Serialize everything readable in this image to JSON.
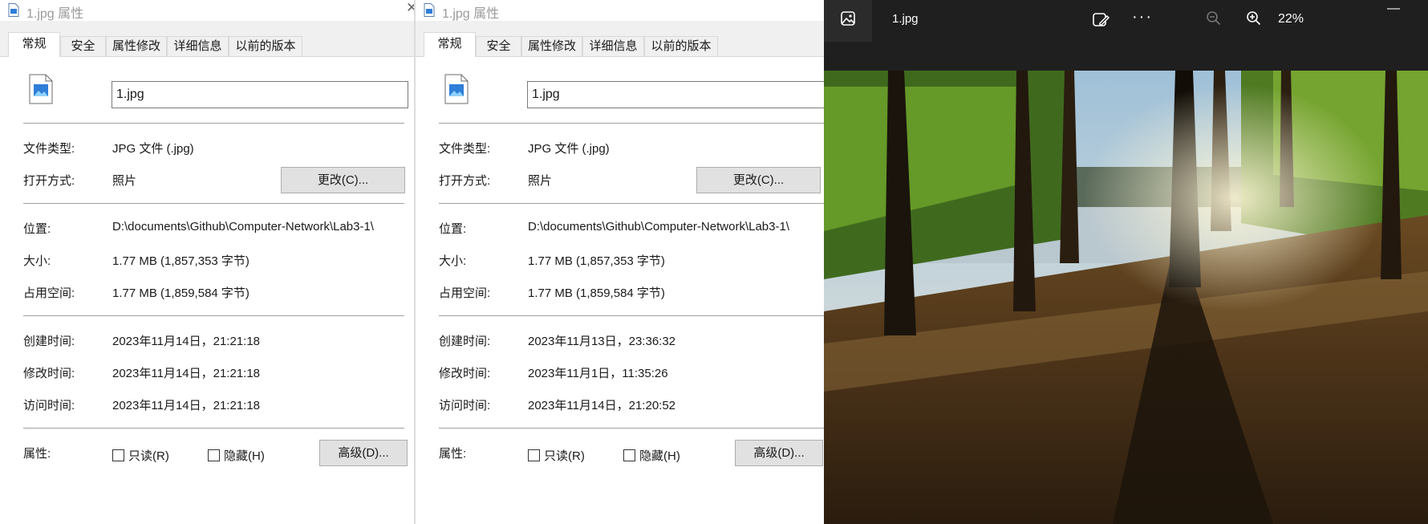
{
  "dialog_left": {
    "title": "1.jpg 属性",
    "tabs": [
      "常规",
      "安全",
      "属性修改",
      "详细信息",
      "以前的版本"
    ],
    "filename": "1.jpg",
    "file_type_label": "文件类型:",
    "file_type_value": "JPG 文件 (.jpg)",
    "open_with_label": "打开方式:",
    "open_with_value": "照片",
    "change_button": "更改(C)...",
    "location_label": "位置:",
    "location_value": "D:\\documents\\Github\\Computer-Network\\Lab3-1\\",
    "size_label": "大小:",
    "size_value": "1.77 MB (1,857,353 字节)",
    "disk_size_label": "占用空间:",
    "disk_size_value": "1.77 MB (1,859,584 字节)",
    "created_label": "创建时间:",
    "created_value": "2023年11月14日，21:21:18",
    "modified_label": "修改时间:",
    "modified_value": "2023年11月14日，21:21:18",
    "accessed_label": "访问时间:",
    "accessed_value": "2023年11月14日，21:21:18",
    "attributes_label": "属性:",
    "readonly_label": "只读(R)",
    "hidden_label": "隐藏(H)",
    "advanced_button": "高级(D)..."
  },
  "dialog_right": {
    "title": "1.jpg 属性",
    "tabs": [
      "常规",
      "安全",
      "属性修改",
      "详细信息",
      "以前的版本"
    ],
    "filename": "1.jpg",
    "file_type_label": "文件类型:",
    "file_type_value": "JPG 文件 (.jpg)",
    "open_with_label": "打开方式:",
    "open_with_value": "照片",
    "change_button": "更改(C)...",
    "location_label": "位置:",
    "location_value": "D:\\documents\\Github\\Computer-Network\\Lab3-1\\",
    "size_label": "大小:",
    "size_value": "1.77 MB (1,857,353 字节)",
    "disk_size_label": "占用空间:",
    "disk_size_value": "1.77 MB (1,859,584 字节)",
    "created_label": "创建时间:",
    "created_value": "2023年11月13日，23:36:32",
    "modified_label": "修改时间:",
    "modified_value": "2023年11月1日，11:35:26",
    "accessed_label": "访问时间:",
    "accessed_value": "2023年11月14日，21:20:52",
    "attributes_label": "属性:",
    "readonly_label": "只读(R)",
    "hidden_label": "隐藏(H)",
    "advanced_button": "高级(D)..."
  },
  "viewer": {
    "filename": "1.jpg",
    "zoom": "22%",
    "icons": [
      "gallery-icon",
      "edit-image-icon",
      "more-icon",
      "zoom-out-icon",
      "zoom-in-icon",
      "minimize-icon"
    ]
  },
  "colors": {
    "viewer_bg": "#1f1f1f",
    "dialog_bg": "#ffffff",
    "tab_bg": "#f0f0f0",
    "button_bg": "#e1e1e1",
    "title_gray": "#9a9a9a"
  }
}
